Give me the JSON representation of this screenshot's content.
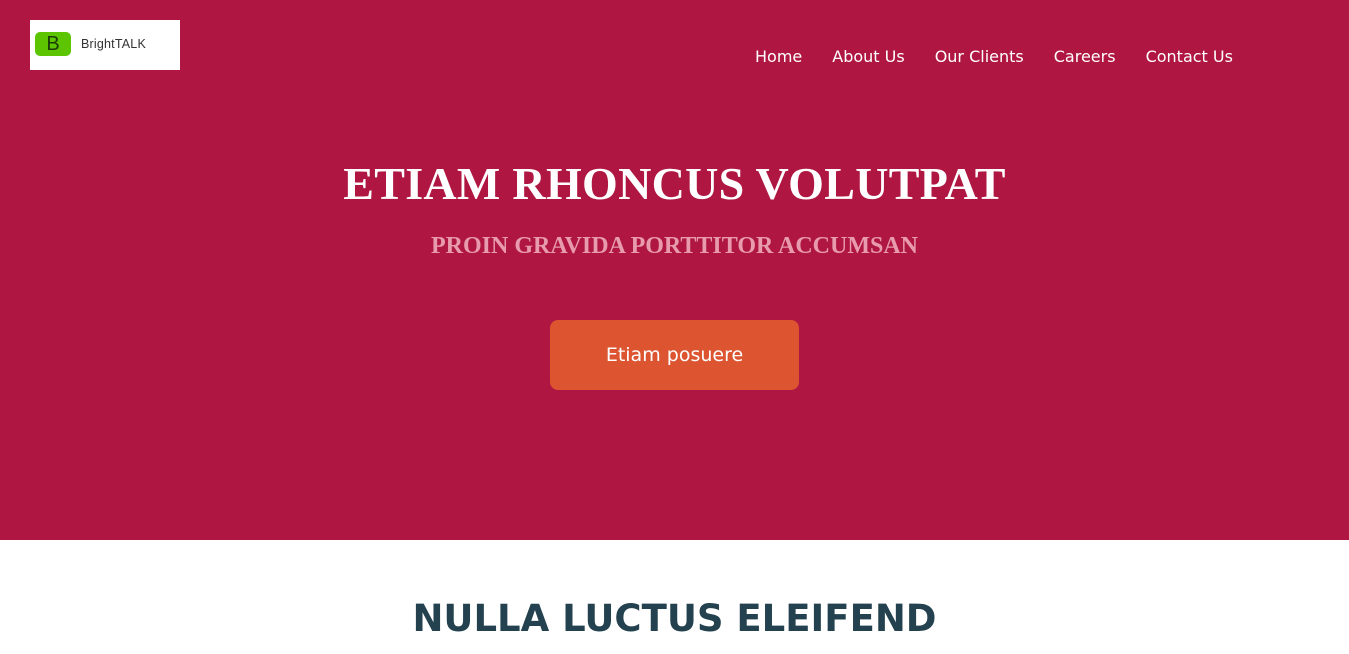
{
  "header": {
    "logo": {
      "badge_letter": "B",
      "text": "BrightTALK"
    },
    "nav": [
      {
        "label": "Home"
      },
      {
        "label": "About Us"
      },
      {
        "label": "Our Clients"
      },
      {
        "label": "Careers"
      },
      {
        "label": "Contact Us"
      }
    ]
  },
  "hero": {
    "title": "ETIAM RHONCUS VOLUTPAT",
    "subtitle": "PROIN GRAVIDA PORTTITOR ACCUMSAN",
    "cta_label": "Etiam posuere"
  },
  "section": {
    "title": "NULLA LUCTUS ELEIFEND"
  },
  "colors": {
    "hero_background": "#af1742",
    "cta_background": "#dc5530",
    "subtitle": "#e89aae",
    "section_title": "#23414e",
    "logo_badge": "#5cc400"
  }
}
